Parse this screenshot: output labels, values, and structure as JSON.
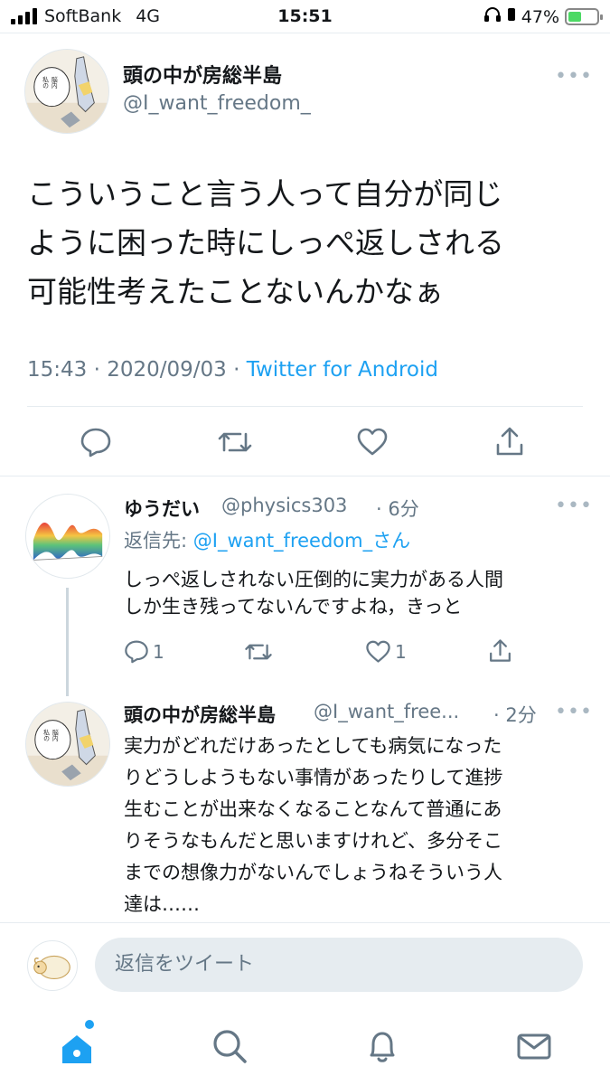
{
  "status_bar": {
    "carrier": "SoftBank",
    "network": "4G",
    "time": "15:51",
    "battery": "47%",
    "battery_level": 0.47
  },
  "main_tweet": {
    "name": "頭の中が房総半島",
    "handle": "@I_want_freedom_",
    "text_lines": [
      "こういうこと言う人って自分が同じ",
      "ように困った時にしっぺ返しされる",
      "可能性考えたことないんかなぁ"
    ],
    "timestamp": "15:43 · 2020/09/03 · ",
    "via": "Twitter for Android",
    "actions": [
      "reply-icon",
      "retweet-icon",
      "like-icon",
      "share-icon"
    ]
  },
  "replies": [
    {
      "name": "ゆうだい",
      "handle": "@physics303",
      "time": "· 6分",
      "reply_to_label": "返信先: ",
      "reply_to_mention": "@I_want_freedom_さん",
      "text_lines": [
        "しっぺ返しされない圧倒的に実力がある人間",
        "しか生き残ってないんですよね，きっと"
      ],
      "reply_count": "1",
      "like_count": "1"
    },
    {
      "name": "頭の中が房総半島",
      "handle": "@I_want_free...",
      "time": "· 2分",
      "text_lines": [
        "実力がどれだけあったとしても病気になった",
        "りどうしようもない事情があったりして進捗",
        "生むことが出来なくなることなんて普通にあ",
        "りそうなもんだと思いますけれど、多分そこ",
        "までの想像力がないんでしょうねそういう人",
        "達は……"
      ]
    }
  ],
  "composer": {
    "placeholder": "返信をツイート"
  },
  "tab_bar": {
    "tabs": [
      "home-icon",
      "search-icon",
      "notifications-icon",
      "messages-icon"
    ]
  },
  "colors": {
    "accent": "#1da1f2",
    "secondary_text": "#657786",
    "battery_green": "#4cd964"
  },
  "more_glyph": "•••"
}
